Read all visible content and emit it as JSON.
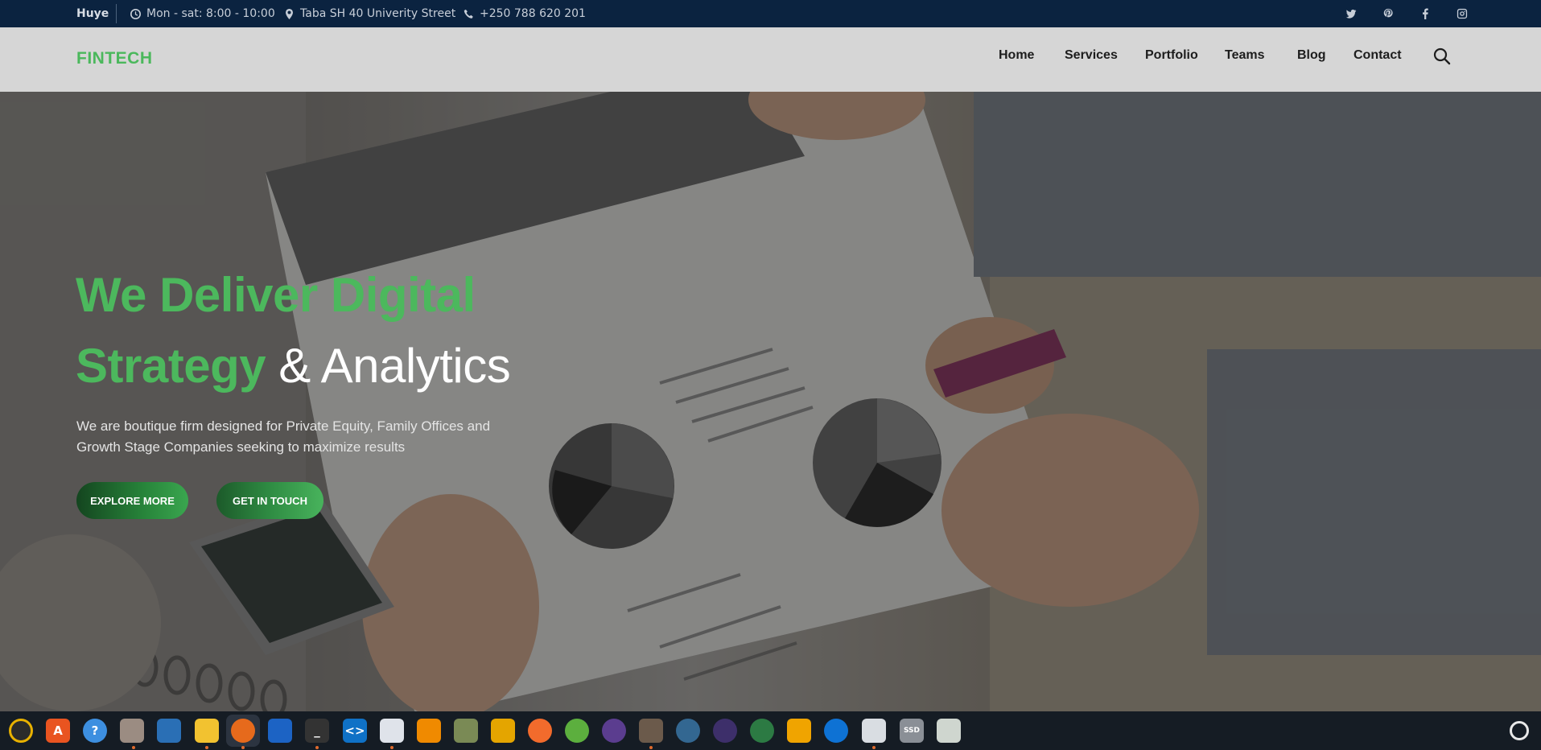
{
  "topbar": {
    "city": "Huye",
    "hours": "Mon - sat: 8:00 - 10:00",
    "address": "Taba SH 40 Univerity Street",
    "phone": "+250 788 620 201",
    "social": [
      "twitter-icon",
      "pinterest-icon",
      "facebook-icon",
      "instagram-icon"
    ]
  },
  "navbar": {
    "logo": "FINTECH",
    "items": [
      "Home",
      "Services",
      "Portfolio",
      "Teams",
      "Blog",
      "Contact"
    ]
  },
  "hero": {
    "title_line1": "We Deliver Digital",
    "title_line2_green": "Strategy",
    "title_line2_white": "& Analytics",
    "description": "We are boutique firm designed for Private Equity, Family Offices and Growth Stage Companies seeking to maximize results",
    "button_explore": "EXPLORE MORE",
    "button_touch": "GET IN TOUCH"
  },
  "colors": {
    "topbar_bg": "#0b2340",
    "navbar_bg": "#d6d6d6",
    "accent_green": "#4cb85d",
    "taskbar_bg": "#151c24"
  },
  "taskbar": {
    "apps": [
      "rhythmbox-icon",
      "app-center-icon",
      "help-icon",
      "files-icon",
      "libreoffice-icon",
      "notes-icon",
      "firefox-icon",
      "wireshark-icon",
      "terminal-icon",
      "vscode-icon",
      "text-editor-icon",
      "vlc-icon",
      "gnome-tweaks-icon",
      "calculator-icon",
      "postman-icon",
      "spring-icon",
      "eye-of-gnome-icon",
      "gimp-icon",
      "postgresql-icon",
      "inkscape-icon",
      "color-picker-icon",
      "archive-icon",
      "teamviewer-icon",
      "presentation-icon",
      "ssd-icon",
      "recycle-bin-icon"
    ],
    "settings": "settings-icon"
  }
}
